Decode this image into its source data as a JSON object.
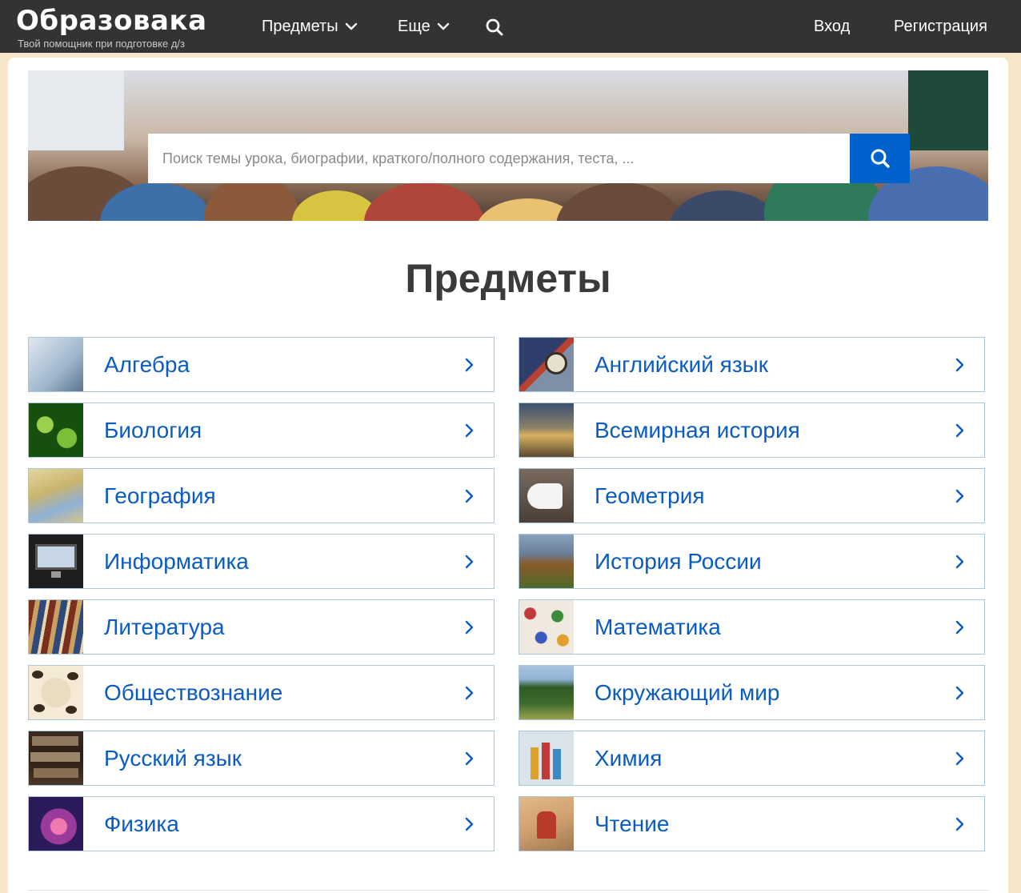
{
  "header": {
    "logo": "Образовака",
    "tagline": "Твой помощник при подготовке д/з",
    "nav": [
      {
        "label": "Предметы"
      },
      {
        "label": "Еще"
      }
    ],
    "login": "Вход",
    "register": "Регистрация"
  },
  "search": {
    "placeholder": "Поиск темы урока, биографии, краткого/полного содержания, теста, ..."
  },
  "section_title": "Предметы",
  "subjects_left": [
    {
      "label": "Алгебра",
      "thumb_colors": [
        "#c8d8e8",
        "#8aa3bd"
      ]
    },
    {
      "label": "Биология",
      "thumb_colors": [
        "#1f6b1a",
        "#73b83a"
      ]
    },
    {
      "label": "География",
      "thumb_colors": [
        "#d6c48a",
        "#89a3c9"
      ]
    },
    {
      "label": "Информатика",
      "thumb_colors": [
        "#2a2a2a",
        "#9fb3c8"
      ]
    },
    {
      "label": "Литература",
      "thumb_colors": [
        "#7a3a24",
        "#c89a5a"
      ]
    },
    {
      "label": "Обществознание",
      "thumb_colors": [
        "#efe0c5",
        "#3a2a1e"
      ]
    },
    {
      "label": "Русский язык",
      "thumb_colors": [
        "#2b1e16",
        "#b79c7a"
      ]
    },
    {
      "label": "Физика",
      "thumb_colors": [
        "#1a0f3a",
        "#d54a8a"
      ]
    }
  ],
  "subjects_right": [
    {
      "label": "Английский язык",
      "thumb_colors": [
        "#2f3e6b",
        "#b9412f"
      ]
    },
    {
      "label": "Всемирная история",
      "thumb_colors": [
        "#3d5070",
        "#d8b060"
      ]
    },
    {
      "label": "Геометрия",
      "thumb_colors": [
        "#5a4a40",
        "#f2f2f2"
      ]
    },
    {
      "label": "История России",
      "thumb_colors": [
        "#6a7f9a",
        "#8a5a2a"
      ]
    },
    {
      "label": "Математика",
      "thumb_colors": [
        "#efe9df",
        "#c23a3a"
      ]
    },
    {
      "label": "Окружающий мир",
      "thumb_colors": [
        "#8fb3d6",
        "#3d6b2a"
      ]
    },
    {
      "label": "Химия",
      "thumb_colors": [
        "#d9e3ea",
        "#e0a030"
      ]
    },
    {
      "label": "Чтение",
      "thumb_colors": [
        "#d0a070",
        "#b83a2a"
      ]
    }
  ],
  "colors": {
    "header_bg": "#333333",
    "accent": "#0062cc",
    "link": "#0a5cc2",
    "page_bg": "#f6e7c9"
  }
}
